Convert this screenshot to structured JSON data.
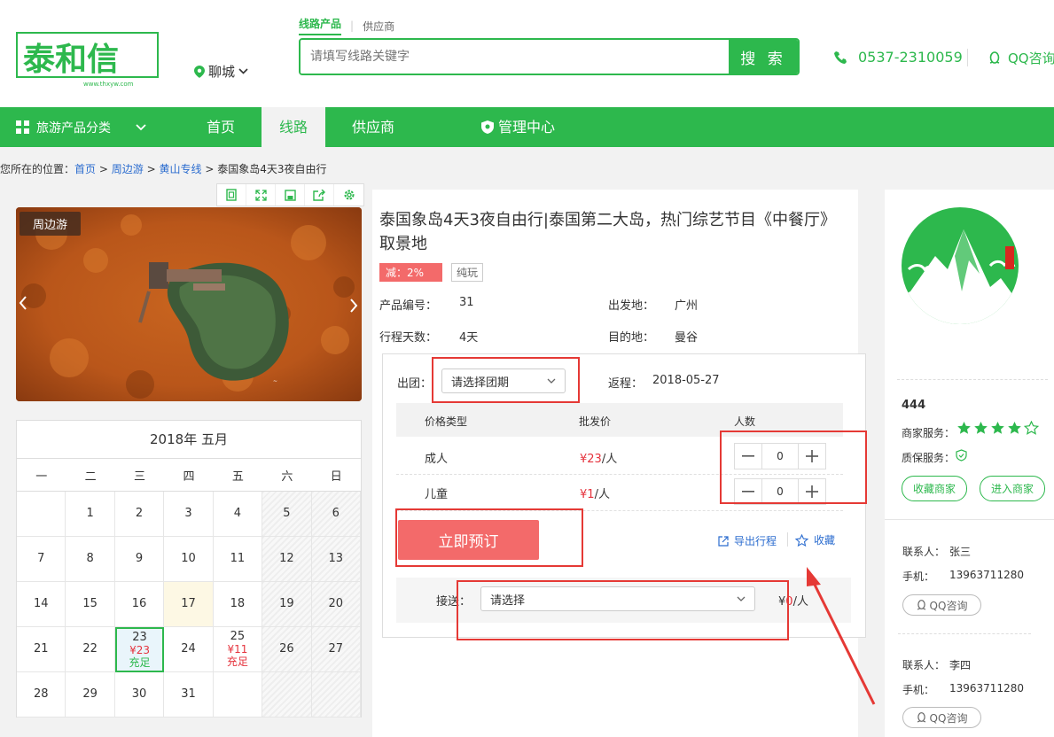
{
  "header": {
    "logo_text": "泰和信",
    "logo_url_text": "www.thxyw.com",
    "city": "聊城",
    "tabs": [
      "线路产品",
      "供应商"
    ],
    "search_placeholder": "请填写线路关键字",
    "search_button": "搜 索",
    "phone": "0537-2310059",
    "qq": "QQ咨询"
  },
  "nav": {
    "category": "旅游产品分类",
    "items": [
      "首页",
      "线路",
      "供应商",
      "管理中心"
    ],
    "active": "线路"
  },
  "breadcrumb": {
    "prefix": "您所在的位置：",
    "items": [
      "首页",
      "周边游",
      "黄山专线"
    ],
    "current": "泰国象岛4天3夜自由行",
    "separator": ">"
  },
  "photo": {
    "badge": "周边游"
  },
  "calendar": {
    "title": "2018年 五月",
    "weekdays": [
      "一",
      "二",
      "三",
      "四",
      "五",
      "六",
      "日"
    ],
    "price_23": "¥23",
    "stock_23": "充足",
    "price_25": "¥11",
    "stock_25": "充足"
  },
  "product": {
    "title": "泰国象岛4天3夜自由行|泰国第二大岛，热门综艺节目《中餐厅》取景地",
    "discount_tag": "减：2%",
    "type_tag": "纯玩",
    "code_label": "产品编号：",
    "code": "31",
    "depart_label": "出发地：",
    "depart": "广州",
    "days_label": "行程天数：",
    "days": "4天",
    "dest_label": "目的地：",
    "dest": "曼谷"
  },
  "booking": {
    "group_label": "出团：",
    "group_placeholder": "请选择团期",
    "return_label": "返程：",
    "return_date": "2018-05-27",
    "col_type": "价格类型",
    "col_price": "批发价",
    "col_count": "人数",
    "adult_label": "成人",
    "adult_price_sym": "¥",
    "adult_price": "23",
    "per_person": "/人",
    "adult_count": "0",
    "child_label": "儿童",
    "child_price_sym": "¥",
    "child_price": "1",
    "child_count": "0",
    "book_button": "立即预订",
    "export_link": "导出行程",
    "fav_link": "收藏",
    "pickup_label": "接送：",
    "pickup_placeholder": "请选择",
    "pickup_price_sym": "¥",
    "pickup_price": "0",
    "pickup_unit": "/人"
  },
  "merchant": {
    "name": "444",
    "service_label": "商家服务：",
    "rating": 4,
    "rating_max": 5,
    "guarantee_label": "质保服务：",
    "fav_button": "收藏商家",
    "enter_button": "进入商家",
    "contacts": [
      {
        "name_label": "联系人：",
        "name": "张三",
        "phone_label": "手机：",
        "phone": "13963711280",
        "qq": "QQ咨询"
      },
      {
        "name_label": "联系人：",
        "name": "李四",
        "phone_label": "手机：",
        "phone": "13963711280",
        "qq": "QQ咨询"
      }
    ]
  },
  "colors": {
    "brand": "#2db84d",
    "accent": "#f36a6a",
    "annotation": "#e53935"
  }
}
